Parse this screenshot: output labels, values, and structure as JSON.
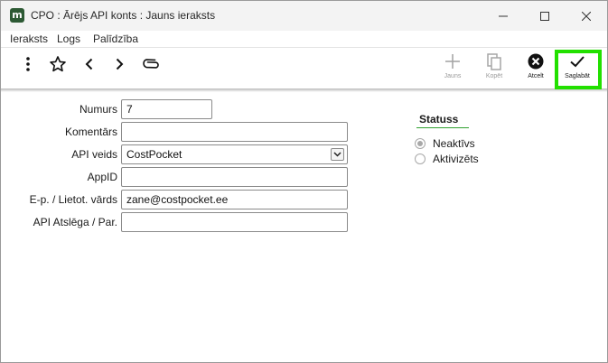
{
  "window": {
    "title": "CPO : Ārējs API konts : Jauns ieraksts",
    "app_icon_letter": "m"
  },
  "menu": {
    "items": [
      "Ieraksts",
      "Logs",
      "Palīdzība"
    ]
  },
  "toolbar": {
    "left_icons": [
      "more-vertical-icon",
      "star-icon",
      "chevron-left-icon",
      "chevron-right-icon",
      "paperclip-icon"
    ],
    "buttons": {
      "new": {
        "label": "Jauns",
        "icon": "plus-icon",
        "enabled": false
      },
      "copy": {
        "label": "Kopēt",
        "icon": "copy-icon",
        "enabled": false
      },
      "cancel": {
        "label": "Atcelt",
        "icon": "cancel-icon",
        "enabled": true
      },
      "save": {
        "label": "Saglabāt",
        "icon": "checkmark-icon",
        "enabled": true,
        "highlight_color": "#22e000"
      }
    }
  },
  "form": {
    "numurs": {
      "label": "Numurs",
      "value": "7"
    },
    "komentars": {
      "label": "Komentārs",
      "value": ""
    },
    "api_veids": {
      "label": "API veids",
      "value": "CostPocket"
    },
    "appid": {
      "label": "AppID",
      "value": ""
    },
    "email": {
      "label": "E-p. / Lietot. vārds",
      "value": "zane@costpocket.ee"
    },
    "api_key": {
      "label": "API Atslēga / Par.",
      "value": ""
    }
  },
  "status": {
    "title": "Statuss",
    "accent_color": "#2fa02f",
    "options": [
      {
        "label": "Neaktīvs",
        "checked": true
      },
      {
        "label": "Aktivizēts",
        "checked": false
      }
    ]
  }
}
